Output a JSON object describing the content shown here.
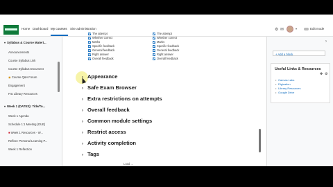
{
  "navbar": {
    "links": [
      "Home",
      "Dashboard",
      "My courses",
      "Site administration"
    ],
    "active_index": 2,
    "edit_mode_label": "Edit mode"
  },
  "drawer": {
    "items": [
      {
        "type": "section",
        "label": "Syllabus & Course Materi..."
      },
      {
        "type": "item",
        "label": "Announcements"
      },
      {
        "type": "item",
        "label": "Course Syllabus Link"
      },
      {
        "type": "item",
        "label": "Course Syllabus Document"
      },
      {
        "type": "item",
        "label": "Course Q&A Forum"
      },
      {
        "type": "item",
        "label": "Engagement"
      },
      {
        "type": "item",
        "label": "FIU Library Resources"
      },
      {
        "type": "section",
        "label": "Week 1 (DATES): Title/To..."
      },
      {
        "type": "item",
        "label": "Week 1 Agenda"
      },
      {
        "type": "item",
        "label": "Schedule 1:1 Meeting (DUE)"
      },
      {
        "type": "item",
        "label": "Week 1 Resources - W..."
      },
      {
        "type": "item",
        "label": "Reflect: Personal Learning P..."
      },
      {
        "type": "item",
        "label": "Week 1 Reflection"
      }
    ]
  },
  "review_options": {
    "left": [
      "The attempt",
      "Whether correct",
      "Marks",
      "Specific feedback",
      "General feedback",
      "Right answer",
      "Overall feedback"
    ],
    "right": [
      "The attempt",
      "Whether correct",
      "Marks",
      "Specific feedback",
      "General feedback",
      "Right answer",
      "Overall feedback"
    ]
  },
  "sections": [
    "Appearance",
    "Safe Exam Browser",
    "Extra restrictions on attempts",
    "Overall feedback",
    "Common module settings",
    "Restrict access",
    "Activity completion",
    "Tags"
  ],
  "bottom_fragment": "Load ...",
  "right_drawer": {
    "add_block": "+ Add a block",
    "links_title": "Useful Links & Resources",
    "links": [
      "Canvas Labs",
      "Digication",
      "Library Resources",
      "Google Drive"
    ]
  },
  "colors": {
    "primary": "#0f6cbf",
    "logo": "#0f7a3a"
  }
}
